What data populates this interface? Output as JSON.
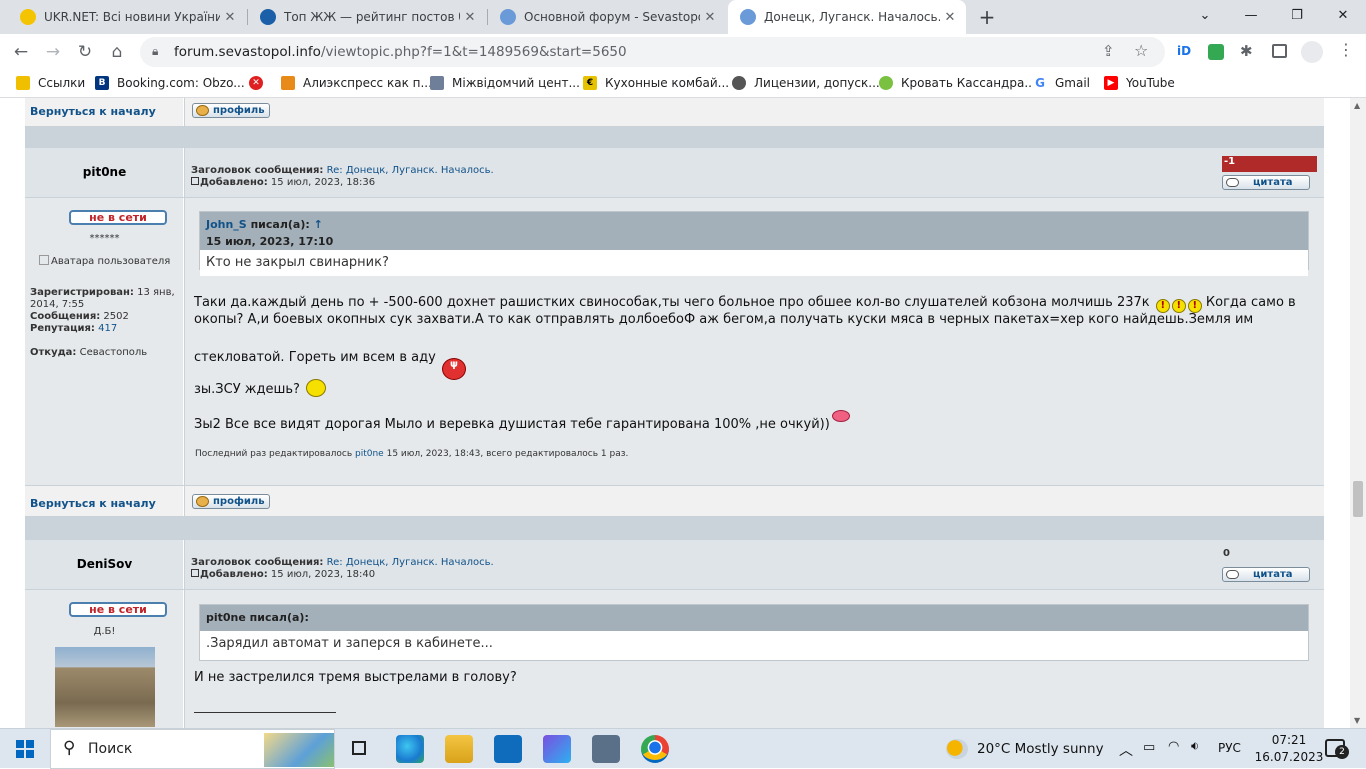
{
  "browser": {
    "tabs": [
      {
        "title": "UKR.NET: Всі новини України, ос",
        "favicon_color": "#f5c400"
      },
      {
        "title": "Топ ЖЖ — рейтинг постов блог",
        "favicon_color": "#1a5fa8"
      },
      {
        "title": "Основной форум - Sevastopol.in",
        "favicon_color": "#6a9bd8"
      },
      {
        "title": "Донецк, Луганск. Началось. - Ст",
        "favicon_color": "#6a9bd8"
      }
    ],
    "active_tab": 3,
    "new_tab_glyph": "+",
    "url_host": "forum.sevastopol.info",
    "url_path": "/viewtopic.php?f=1&t=1489569&start=5650",
    "bookmarks": [
      {
        "label": "Ссылки",
        "icon": "folder-icon",
        "color": "#f0c000"
      },
      {
        "label": "Booking.com: Obzo...",
        "icon": "booking-icon",
        "color": "#003580"
      },
      {
        "label": "",
        "icon": "red-x-icon",
        "color": "#e02020"
      },
      {
        "label": "Алиэкспресс как п...",
        "icon": "box-icon",
        "color": "#e88a1a"
      },
      {
        "label": "Міжвідомчий цент...",
        "icon": "grid-icon",
        "color": "#6f7f9a"
      },
      {
        "label": "Кухонные комбай...",
        "icon": "badge-icon",
        "color": "#e6c200"
      },
      {
        "label": "Лицензии, допуск...",
        "icon": "globe-icon",
        "color": "#555555"
      },
      {
        "label": "Кровать Кассандра...",
        "icon": "leaf-icon",
        "color": "#7ac142"
      },
      {
        "label": "Gmail",
        "icon": "google-icon",
        "color": "#4285f4"
      },
      {
        "label": "YouTube",
        "icon": "youtube-icon",
        "color": "#ff0000"
      }
    ]
  },
  "forum": {
    "back_to_top": "Вернуться к началу",
    "profile_btn": "профиль",
    "quote_btn": "цитата",
    "offline": "не в сети",
    "labels": {
      "subject": "Заголовок сообщения:",
      "added": "Добавлено:",
      "registered": "Зарегистрирован:",
      "messages": "Сообщения:",
      "reputation": "Репутация:",
      "from": "Откуда:"
    },
    "post1": {
      "author": "pit0ne",
      "rank": "******",
      "avatar_alt": "Аватара пользователя",
      "registered": "13 янв, 2014, 7:55",
      "messages": "2502",
      "reputation": "417",
      "from": "Севастополь",
      "subject": "Re: Донецк, Луганск. Началось.",
      "added": "15 июл, 2023, 18:36",
      "score": "-1",
      "quote_author": "John_S",
      "quote_wrote": "писал(а):",
      "quote_arrow": "↑",
      "quote_date": "15 июл, 2023, 17:10",
      "quote_text": "Кто не закрыл свинарник?",
      "line1": "Таки да.каждый день по + -500-600 дохнет рашистких свиноcобак,ты чего больное про обшее кол-во слушателей кобзона молчишь 237к",
      "line1b": "Когда само в",
      "line2": "окопы? А,и боевых окопных сук захвати.А то как отправлять долбоебоФ аж бегом,а получать куски мяса в черных пакетах=хер кого найдешь.Земля им",
      "line3": "стекловатой. Гореть им всем в аду",
      "line4": "зы.ЗСУ ждешь?",
      "line5": "Зы2 Все все видят дорогая Мыло и веревка душистая тебе гарантирована 100% ,не очкуй))",
      "edit_prefix": "Последний раз редактировалось",
      "edit_user": "pit0ne",
      "edit_suffix": "15 июл, 2023, 18:43, всего редактировалось 1 раз."
    },
    "post2": {
      "author": "DeniSov",
      "rank": "Д.Б!",
      "subject": "Re: Донецк, Луганск. Началось.",
      "added": "15 июл, 2023, 18:40",
      "score": "0",
      "quote_header": "pit0ne писал(а):",
      "quote_text": ".Зарядил автомат и заперся в кабинете...",
      "line1": "И не застрелился тремя выстрелами в голову?"
    }
  },
  "taskbar": {
    "search_label": "Поиск",
    "weather": "20°C  Mostly sunny",
    "lang": "РУС",
    "time": "07:21",
    "date": "16.07.2023",
    "notif_count": "2"
  }
}
